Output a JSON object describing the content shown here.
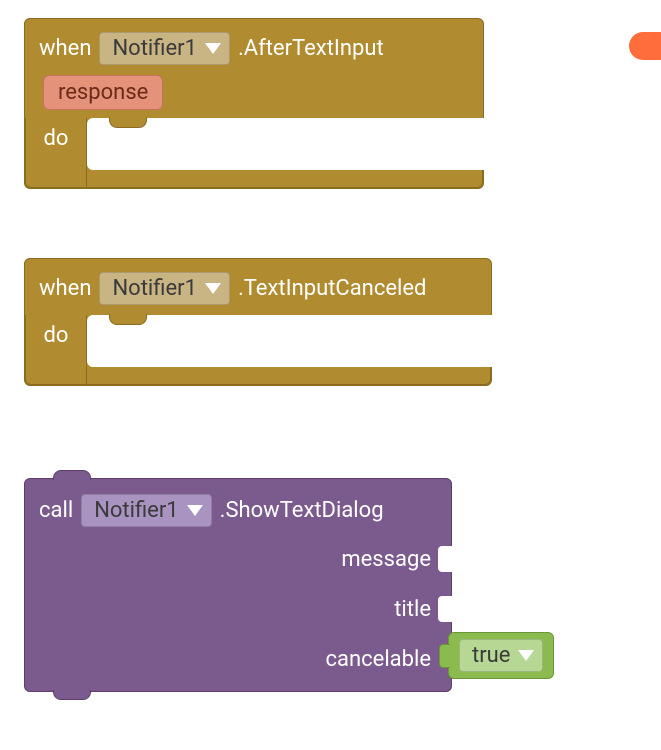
{
  "corner_tab_color": "#ff6d3b",
  "blocks": {
    "event1": {
      "keyword": "when",
      "component": "Notifier1",
      "event": ".AfterTextInput",
      "params": [
        "response"
      ],
      "do_label": "do"
    },
    "event2": {
      "keyword": "when",
      "component": "Notifier1",
      "event": ".TextInputCanceled",
      "do_label": "do"
    },
    "call1": {
      "keyword": "call",
      "component": "Notifier1",
      "method": ".ShowTextDialog",
      "args": [
        {
          "name": "message",
          "value": null
        },
        {
          "name": "title",
          "value": null
        },
        {
          "name": "cancelable",
          "value": "true"
        }
      ]
    }
  },
  "colors": {
    "event_block": "#b08b2f",
    "call_block": "#7b5a8e",
    "value_block": "#8bbb4e",
    "param_chip": "#e4937a"
  }
}
